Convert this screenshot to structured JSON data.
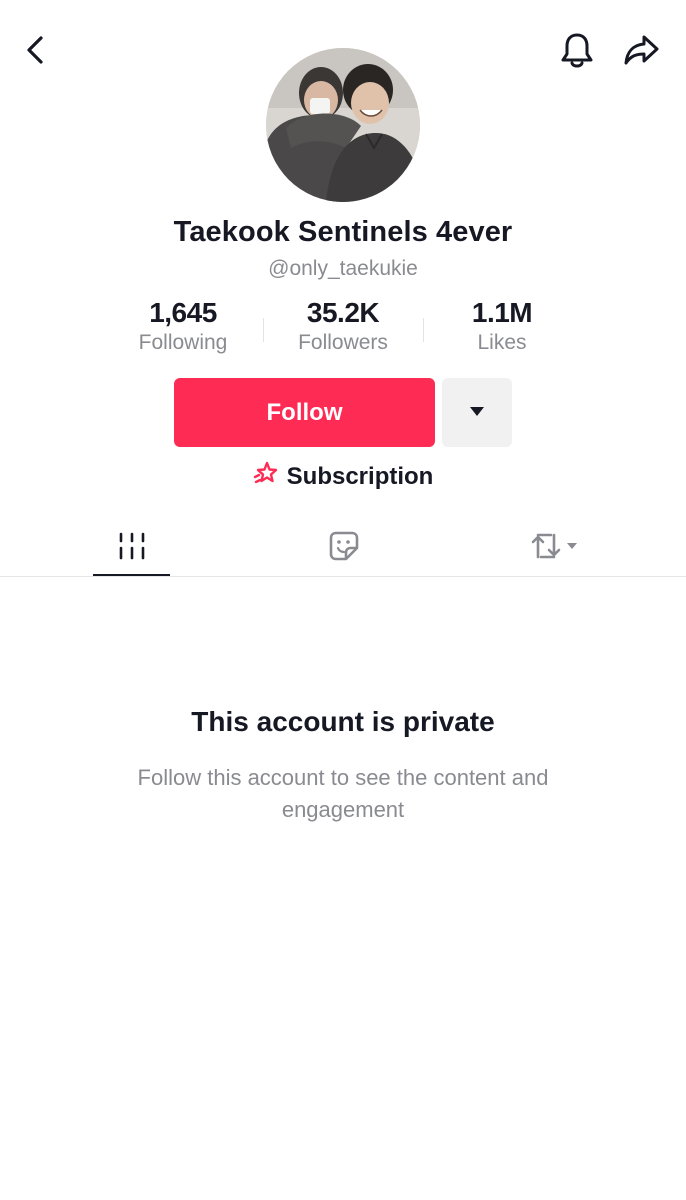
{
  "header": {
    "back_icon": "chevron-left-icon",
    "notification_icon": "bell-icon",
    "share_icon": "share-arrow-icon"
  },
  "profile": {
    "display_name": "Taekook Sentinels 4ever",
    "username": "@only_taekukie"
  },
  "stats": {
    "following": {
      "value": "1,645",
      "label": "Following"
    },
    "followers": {
      "value": "35.2K",
      "label": "Followers"
    },
    "likes": {
      "value": "1.1M",
      "label": "Likes"
    }
  },
  "actions": {
    "follow_label": "Follow",
    "more_icon": "caret-down-icon",
    "subscription_label": "Subscription",
    "subscription_icon": "star-sparkle-icon"
  },
  "tabs": [
    {
      "name": "videos",
      "icon": "grid-lines-icon",
      "active": true
    },
    {
      "name": "liked",
      "icon": "sticker-icon",
      "active": false
    },
    {
      "name": "reposts",
      "icon": "repost-icon",
      "active": false
    }
  ],
  "private_notice": {
    "title": "This account is private",
    "description": "Follow this account to see the content and engagement"
  },
  "colors": {
    "accent": "#fe2c55",
    "text_primary": "#161823",
    "text_secondary": "#8a8b91",
    "button_secondary_bg": "#f1f1f2"
  }
}
